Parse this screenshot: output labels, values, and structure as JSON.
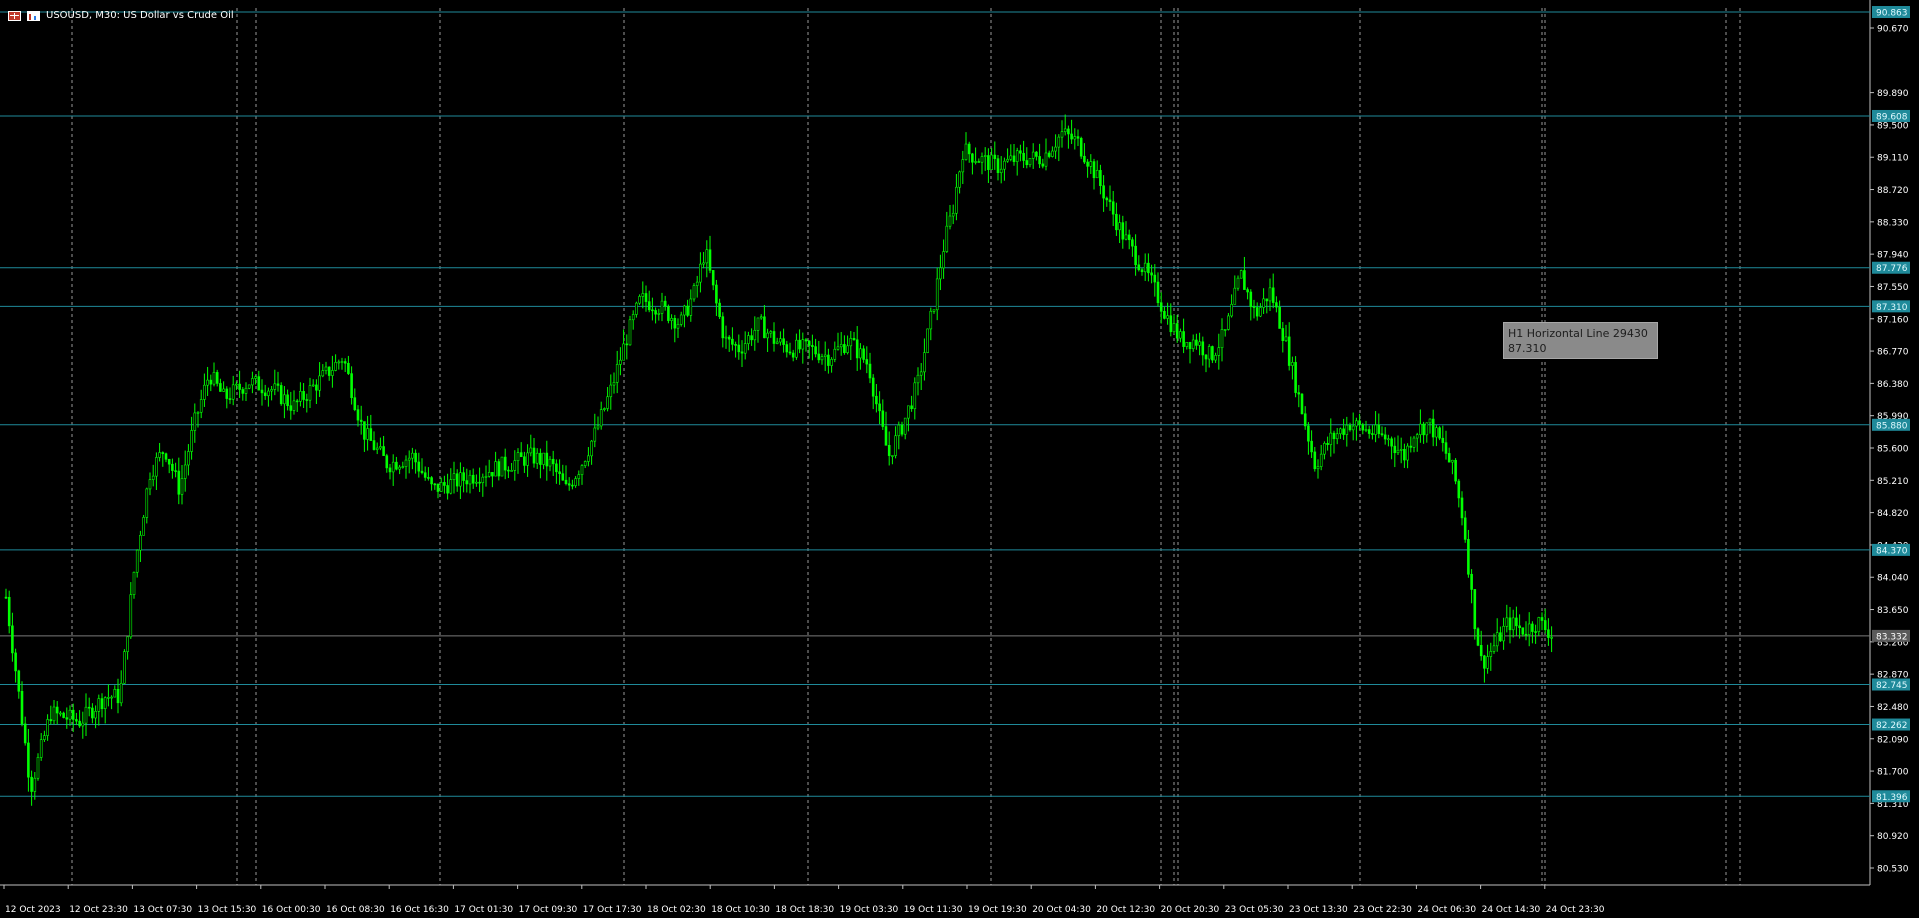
{
  "window": {
    "title": "USOUSD, M30:  US Dollar vs Crude Oil"
  },
  "tooltip": {
    "name": "H1 Horizontal Line 29430",
    "value": "87.310"
  },
  "colors": {
    "background": "#000000",
    "candle": "#00ff00",
    "horizontal_line": "#1f8a9a",
    "vertical_line": "#bfbfbf",
    "price_badge": "#1f8a9a",
    "current_price_badge": "#5a5a5a"
  },
  "icons": [
    "table-icon",
    "chart-icon"
  ],
  "chart_data": {
    "type": "candlestick",
    "symbol": "USOUSD",
    "timeframe": "M30",
    "ylim": [
      80.2,
      91.0
    ],
    "y_ticks": [
      "90.670",
      "89.890",
      "89.500",
      "89.110",
      "88.720",
      "88.330",
      "87.940",
      "87.550",
      "87.160",
      "86.770",
      "86.380",
      "85.990",
      "85.600",
      "85.210",
      "84.820",
      "84.430",
      "84.040",
      "83.650",
      "83.260",
      "82.870",
      "82.480",
      "82.090",
      "81.700",
      "81.310",
      "80.920",
      "80.530"
    ],
    "x_ticks": [
      "12 Oct 2023",
      "12 Oct 23:30",
      "13 Oct 07:30",
      "13 Oct 15:30",
      "16 Oct 00:30",
      "16 Oct 08:30",
      "16 Oct 16:30",
      "17 Oct 01:30",
      "17 Oct 09:30",
      "17 Oct 17:30",
      "18 Oct 02:30",
      "18 Oct 10:30",
      "18 Oct 18:30",
      "19 Oct 03:30",
      "19 Oct 11:30",
      "19 Oct 19:30",
      "20 Oct 04:30",
      "20 Oct 12:30",
      "20 Oct 20:30",
      "23 Oct 05:30",
      "23 Oct 13:30",
      "23 Oct 22:30",
      "24 Oct 06:30",
      "24 Oct 14:30",
      "24 Oct 23:30"
    ],
    "horizontal_lines": [
      {
        "price": 90.863,
        "label": "90.863"
      },
      {
        "price": 89.608,
        "label": "89.608"
      },
      {
        "price": 87.776,
        "label": "87.776"
      },
      {
        "price": 87.31,
        "label": "87.310"
      },
      {
        "price": 85.88,
        "label": "85.880"
      },
      {
        "price": 84.37,
        "label": "84.370"
      },
      {
        "price": 82.745,
        "label": "82.745"
      },
      {
        "price": 82.262,
        "label": "82.262"
      },
      {
        "price": 81.396,
        "label": "81.396"
      }
    ],
    "current_price": {
      "price": 83.332,
      "label": "83.332"
    },
    "price_path": [
      [
        0,
        83.8
      ],
      [
        10,
        82.9
      ],
      [
        25,
        81.5
      ],
      [
        45,
        82.4
      ],
      [
        75,
        82.3
      ],
      [
        100,
        82.6
      ],
      [
        115,
        82.6
      ],
      [
        130,
        84.2
      ],
      [
        145,
        85.3
      ],
      [
        160,
        85.6
      ],
      [
        175,
        85.1
      ],
      [
        190,
        85.9
      ],
      [
        205,
        86.5
      ],
      [
        220,
        86.2
      ],
      [
        245,
        86.4
      ],
      [
        270,
        86.3
      ],
      [
        290,
        86.1
      ],
      [
        315,
        86.4
      ],
      [
        340,
        86.7
      ],
      [
        360,
        85.8
      ],
      [
        385,
        85.4
      ],
      [
        410,
        85.5
      ],
      [
        430,
        85.1
      ],
      [
        455,
        85.2
      ],
      [
        480,
        85.3
      ],
      [
        505,
        85.4
      ],
      [
        530,
        85.5
      ],
      [
        550,
        85.4
      ],
      [
        565,
        85.1
      ],
      [
        580,
        85.4
      ],
      [
        595,
        85.8
      ],
      [
        610,
        86.3
      ],
      [
        625,
        86.9
      ],
      [
        640,
        87.4
      ],
      [
        660,
        87.3
      ],
      [
        680,
        87.1
      ],
      [
        695,
        87.5
      ],
      [
        705,
        88.0
      ],
      [
        715,
        87.4
      ],
      [
        725,
        86.9
      ],
      [
        740,
        86.8
      ],
      [
        760,
        87.1
      ],
      [
        775,
        86.9
      ],
      [
        790,
        86.8
      ],
      [
        810,
        86.8
      ],
      [
        830,
        86.7
      ],
      [
        850,
        86.9
      ],
      [
        870,
        86.6
      ],
      [
        880,
        86.0
      ],
      [
        890,
        85.5
      ],
      [
        905,
        85.9
      ],
      [
        920,
        86.4
      ],
      [
        935,
        87.3
      ],
      [
        945,
        88.0
      ],
      [
        955,
        88.5
      ],
      [
        965,
        89.2
      ],
      [
        980,
        89.1
      ],
      [
        1000,
        89.0
      ],
      [
        1020,
        89.1
      ],
      [
        1045,
        89.1
      ],
      [
        1065,
        89.4
      ],
      [
        1080,
        89.3
      ],
      [
        1095,
        89.0
      ],
      [
        1110,
        88.6
      ],
      [
        1125,
        88.2
      ],
      [
        1140,
        87.9
      ],
      [
        1155,
        87.6
      ],
      [
        1170,
        87.2
      ],
      [
        1185,
        86.9
      ],
      [
        1200,
        86.9
      ],
      [
        1215,
        86.7
      ],
      [
        1230,
        87.0
      ],
      [
        1245,
        87.7
      ],
      [
        1260,
        87.2
      ],
      [
        1275,
        87.5
      ],
      [
        1290,
        86.9
      ],
      [
        1300,
        86.4
      ],
      [
        1310,
        85.9
      ],
      [
        1320,
        85.4
      ],
      [
        1335,
        85.7
      ],
      [
        1355,
        85.9
      ],
      [
        1375,
        85.8
      ],
      [
        1395,
        85.7
      ],
      [
        1410,
        85.5
      ],
      [
        1420,
        85.8
      ],
      [
        1435,
        85.9
      ],
      [
        1450,
        85.6
      ],
      [
        1460,
        85.3
      ],
      [
        1470,
        84.7
      ],
      [
        1480,
        83.6
      ],
      [
        1488,
        83.0
      ],
      [
        1495,
        83.1
      ],
      [
        1505,
        83.3
      ],
      [
        1515,
        83.5
      ],
      [
        1530,
        83.4
      ],
      [
        1545,
        83.5
      ],
      [
        1555,
        83.4
      ],
      [
        1560,
        83.33
      ]
    ]
  }
}
